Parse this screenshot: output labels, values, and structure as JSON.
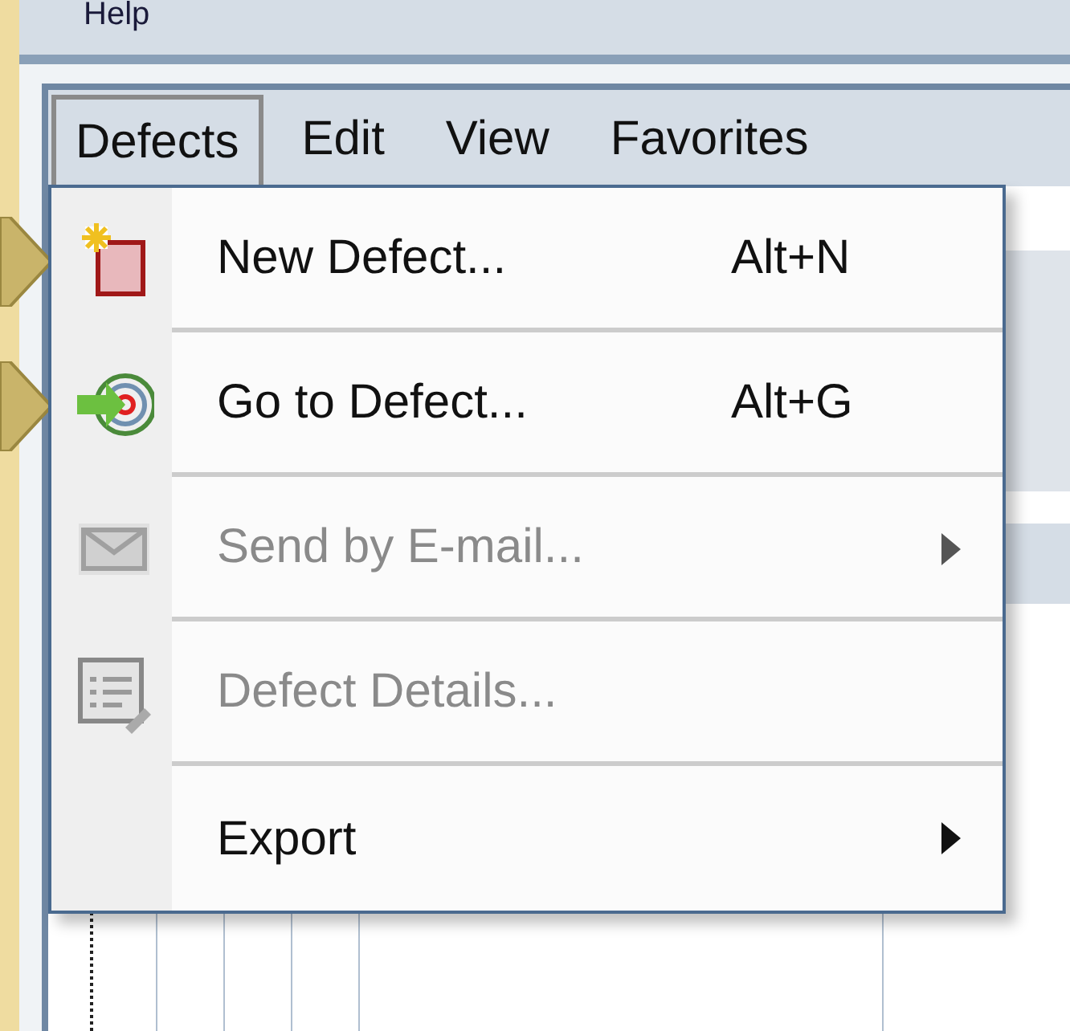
{
  "app_menu": {
    "label": "Help"
  },
  "menubar": [
    {
      "label": "Defects",
      "selected": true
    },
    {
      "label": "Edit",
      "selected": false
    },
    {
      "label": "View",
      "selected": false
    },
    {
      "label": "Favorites",
      "selected": false
    }
  ],
  "menu": [
    {
      "label": "New Defect...",
      "shortcut": "Alt+N",
      "kind": "new",
      "disabled": false,
      "submenu": false,
      "callout": true
    },
    {
      "label": "Go to Defect...",
      "shortcut": "Alt+G",
      "kind": "goto",
      "disabled": false,
      "submenu": false,
      "callout": true
    },
    {
      "label": "Send by E-mail...",
      "kind": "mail",
      "disabled": true,
      "submenu": true,
      "callout": false
    },
    {
      "label": "Defect Details...",
      "kind": "details",
      "disabled": true,
      "submenu": false,
      "callout": false
    },
    {
      "label": "Export",
      "kind": "plain",
      "disabled": false,
      "submenu": true,
      "callout": false
    }
  ]
}
